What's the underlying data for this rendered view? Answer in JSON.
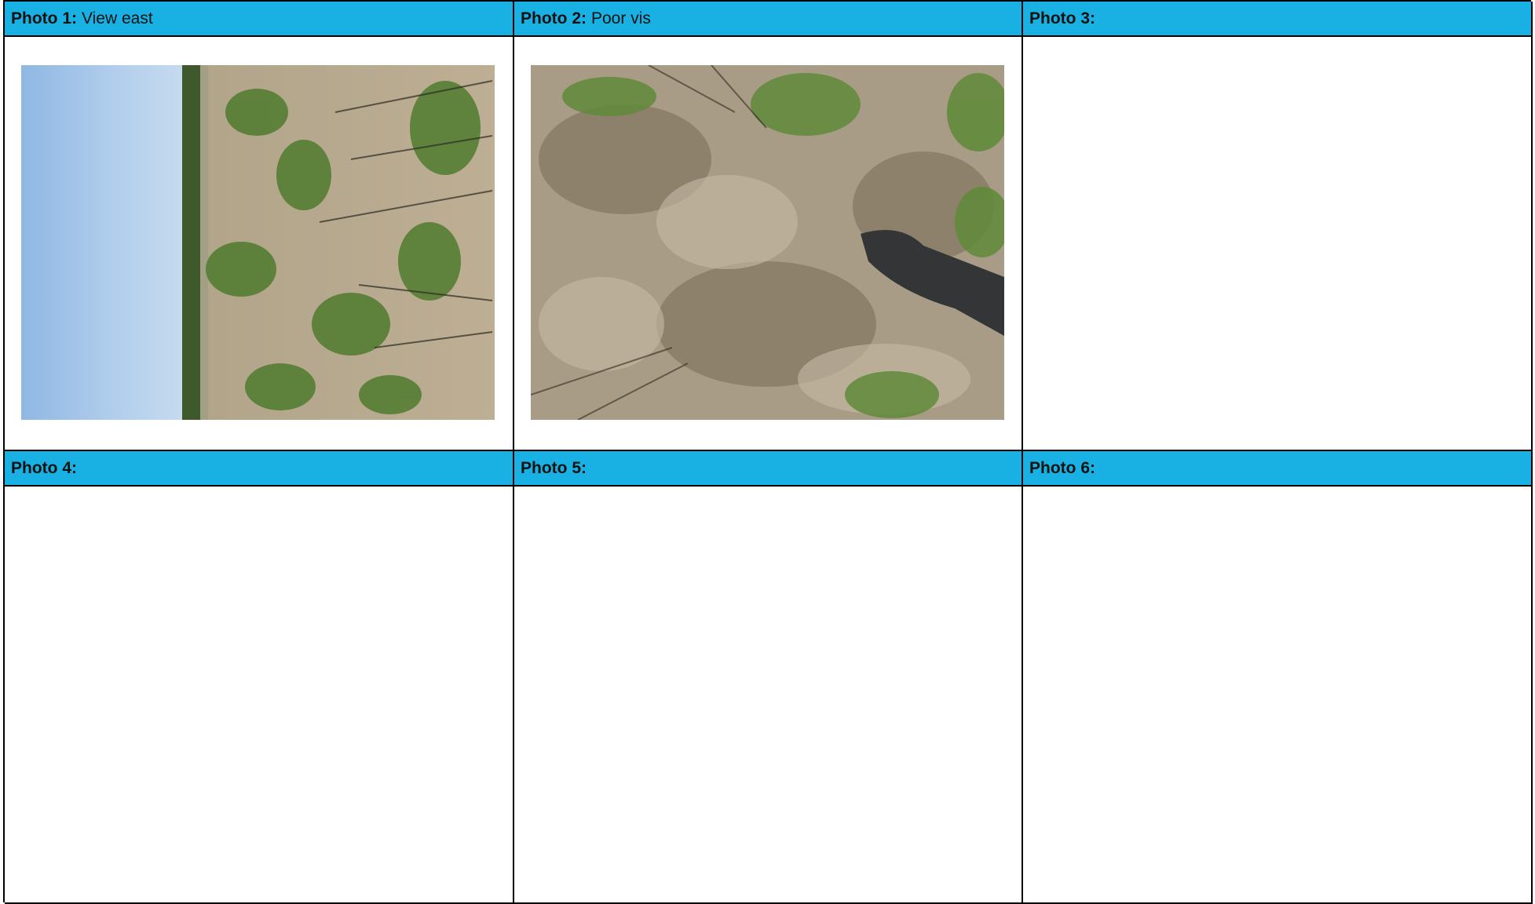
{
  "photos": [
    {
      "label": "Photo 1:",
      "caption": "View east",
      "image": "photo of eucalypt woodland and regrowth under blue sky"
    },
    {
      "label": "Photo 2:",
      "caption": "Poor vis",
      "image": "photo of dry grass groundcover with boot in frame"
    },
    {
      "label": "Photo 3:",
      "caption": ""
    },
    {
      "label": "Photo 4:",
      "caption": ""
    },
    {
      "label": "Photo 5:",
      "caption": ""
    },
    {
      "label": "Photo 6:",
      "caption": ""
    }
  ],
  "colors": {
    "header_bg": "#19b1e3",
    "border": "#000000"
  }
}
